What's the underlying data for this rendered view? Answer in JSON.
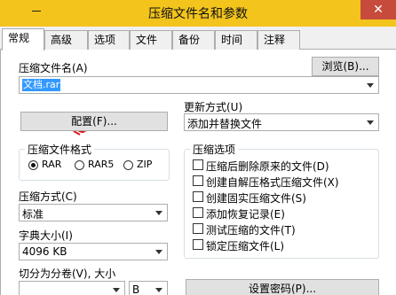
{
  "window": {
    "title": "压缩文件名和参数",
    "close_glyph": "✕"
  },
  "tabs": [
    {
      "label": "常规",
      "active": true
    },
    {
      "label": "高级"
    },
    {
      "label": "选项"
    },
    {
      "label": "文件"
    },
    {
      "label": "备份"
    },
    {
      "label": "时间"
    },
    {
      "label": "注释"
    }
  ],
  "general": {
    "archive_name_label": "压缩文件名(A)",
    "browse_button": "浏览(B)...",
    "archive_name_value": "文档.rar",
    "update_mode_label": "更新方式(U)",
    "update_mode_value": "添加并替换文件",
    "profiles_button": "配置(F)...",
    "format_group_title": "压缩文件格式",
    "formats": [
      {
        "label": "RAR",
        "selected": true
      },
      {
        "label": "RAR5",
        "selected": false
      },
      {
        "label": "ZIP",
        "selected": false
      }
    ],
    "options_group_title": "压缩选项",
    "options": [
      {
        "label": "压缩后删除原来的文件(D)",
        "checked": false
      },
      {
        "label": "创建自解压格式压缩文件(X)",
        "checked": false
      },
      {
        "label": "创建固实压缩文件(S)",
        "checked": false
      },
      {
        "label": "添加恢复记录(E)",
        "checked": false
      },
      {
        "label": "测试压缩的文件(T)",
        "checked": false
      },
      {
        "label": "锁定压缩文件(L)",
        "checked": false
      }
    ],
    "method_label": "压缩方式(C)",
    "method_value": "标准",
    "dict_label": "字典大小(I)",
    "dict_value": "4096 KB",
    "split_label": "切分为分卷(V), 大小",
    "split_value": "",
    "split_unit": "B",
    "password_button": "设置密码(P)..."
  },
  "colors": {
    "titlebar": "#f2c41c",
    "close_button": "#c74b3c",
    "selection": "#3399ff",
    "annotation_scribble": "#e0161a"
  }
}
